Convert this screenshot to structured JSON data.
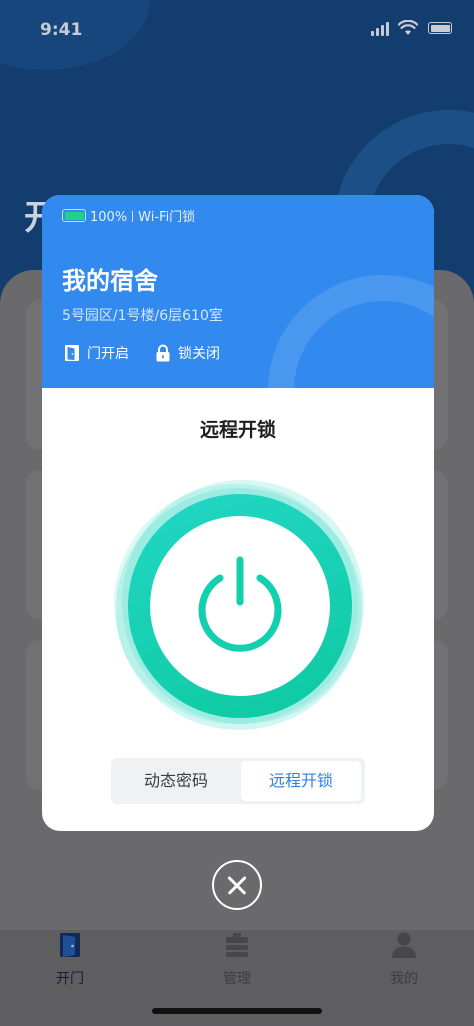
{
  "status_bar": {
    "time": "9:41"
  },
  "background": {
    "title": "开"
  },
  "modal": {
    "battery": "100%",
    "lock_type": "Wi-Fi门锁",
    "room_name": "我的宿舍",
    "address": "5号园区/1号楼/6层610室",
    "door_status": "门开启",
    "lock_status": "锁关闭",
    "heading": "远程开锁",
    "tabs": {
      "dynamic_password": "动态密码",
      "remote_unlock": "远程开锁",
      "selected": "远程开锁"
    }
  },
  "tab_bar": {
    "items": [
      {
        "label": "开门",
        "icon": "door-icon"
      },
      {
        "label": "管理",
        "icon": "toolbox-icon"
      },
      {
        "label": "我的",
        "icon": "user-icon"
      }
    ],
    "active": "开门"
  },
  "colors": {
    "accent_blue": "#3289ee",
    "power_green": "#0dc9a0",
    "selected_tab_text": "#2f7fe4"
  }
}
